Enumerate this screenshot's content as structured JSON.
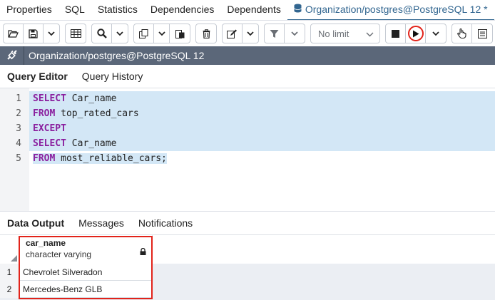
{
  "top_tabs": [
    {
      "label": "Properties"
    },
    {
      "label": "SQL"
    },
    {
      "label": "Statistics"
    },
    {
      "label": "Dependencies"
    },
    {
      "label": "Dependents"
    },
    {
      "label": "Organization/postgres@PostgreSQL 12 *",
      "icon": "database-icon",
      "active": true
    }
  ],
  "toolbar": {
    "limit_select_value": "No limit",
    "icons": [
      "open-file-icon",
      "save-icon",
      "chevron-down-icon",
      "grid-icon",
      "search-icon",
      "chevron-down-icon",
      "copy-icon",
      "chevron-down-icon",
      "paste-icon",
      "delete-icon",
      "edit-icon",
      "chevron-down-icon",
      "filter-icon",
      "chevron-down-icon",
      "stop-icon",
      "execute-icon",
      "chevron-down-icon",
      "hand-icon",
      "explain-icon"
    ]
  },
  "connection": {
    "title": "Organization/postgres@PostgreSQL 12",
    "icon": "connection-plug-icon"
  },
  "query_tabs": [
    {
      "label": "Query Editor",
      "active": true
    },
    {
      "label": "Query History",
      "active": false
    }
  ],
  "editor": {
    "lines": [
      {
        "num": "1",
        "kw": "SELECT",
        "rest": " Car_name"
      },
      {
        "num": "2",
        "kw": "FROM",
        "rest": " top_rated_cars"
      },
      {
        "num": "3",
        "kw": "EXCEPT",
        "rest": ""
      },
      {
        "num": "4",
        "kw": "SELECT",
        "rest": " Car_name"
      },
      {
        "num": "5",
        "kw": "FROM",
        "rest": " most_reliable_cars;"
      }
    ]
  },
  "output_tabs": [
    {
      "label": "Data Output",
      "active": true
    },
    {
      "label": "Messages",
      "active": false
    },
    {
      "label": "Notifications",
      "active": false
    }
  ],
  "grid": {
    "column": {
      "name": "car_name",
      "type": "character varying"
    },
    "rows": [
      {
        "num": "1",
        "value": "Chevrolet Silveradon"
      },
      {
        "num": "2",
        "value": "Mercedes-Benz GLB"
      }
    ]
  },
  "colors": {
    "accent": "#326690",
    "keyword": "#8a1f9e",
    "selection": "#d3e7f6",
    "connection_bar": "#5b6779",
    "highlight_box": "#e2231a"
  }
}
